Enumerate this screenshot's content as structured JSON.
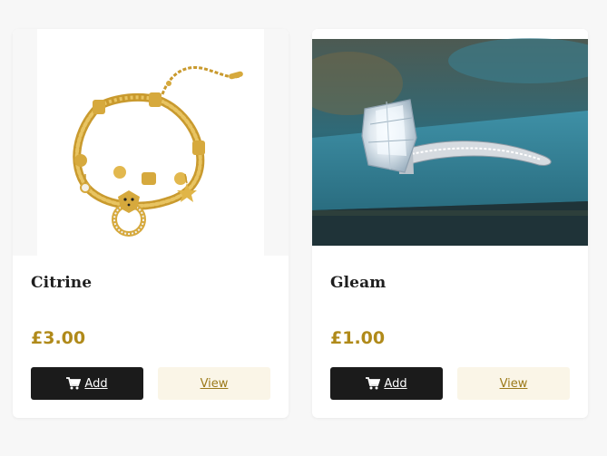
{
  "products": [
    {
      "name": "Citrine",
      "price": "£3.00",
      "add_label": "Add",
      "view_label": "View",
      "image": "gold-bracelet-image"
    },
    {
      "name": "Gleam",
      "price": "£1.00",
      "add_label": "Add",
      "view_label": "View",
      "image": "diamond-ring-image"
    }
  ],
  "colors": {
    "price": "#b08a1a",
    "add_button_bg": "#1b1b1b",
    "view_button_bg": "#faf5e7",
    "view_button_text": "#9c7a1a"
  },
  "icons": {
    "add_button": "cart-icon"
  }
}
